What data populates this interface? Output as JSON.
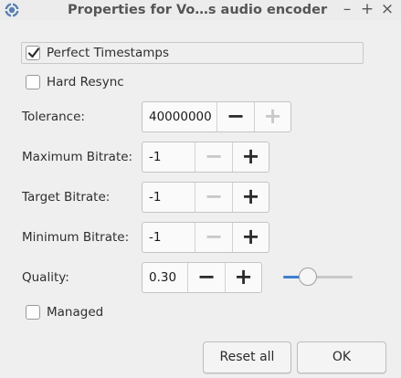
{
  "window": {
    "title": "Properties for Vo…s audio encoder",
    "minimize_glyph": "–",
    "maximize_glyph": "+",
    "close_glyph": "×",
    "icon": "gear-app-icon"
  },
  "checkboxes": {
    "perfect_timestamps": {
      "label": "Perfect Timestamps",
      "checked": true
    },
    "hard_resync": {
      "label": "Hard Resync",
      "checked": false
    },
    "managed": {
      "label": "Managed",
      "checked": false
    }
  },
  "fields": {
    "tolerance": {
      "label": "Tolerance:",
      "value": "40000000",
      "minus_enabled": true,
      "plus_enabled": false
    },
    "maximum_bitrate": {
      "label": "Maximum Bitrate:",
      "value": "-1",
      "minus_enabled": false,
      "plus_enabled": true
    },
    "target_bitrate": {
      "label": "Target Bitrate:",
      "value": "-1",
      "minus_enabled": false,
      "plus_enabled": true
    },
    "minimum_bitrate": {
      "label": "Minimum Bitrate:",
      "value": "-1",
      "minus_enabled": false,
      "plus_enabled": true
    },
    "quality": {
      "label": "Quality:",
      "value": "0.30",
      "minus_enabled": true,
      "plus_enabled": true,
      "slider_level": 0.35
    }
  },
  "spin_glyphs": {
    "minus": "−",
    "plus": "+"
  },
  "buttons": {
    "reset_all": "Reset all",
    "ok": "OK"
  },
  "colors": {
    "accent": "#3e7fd0"
  }
}
